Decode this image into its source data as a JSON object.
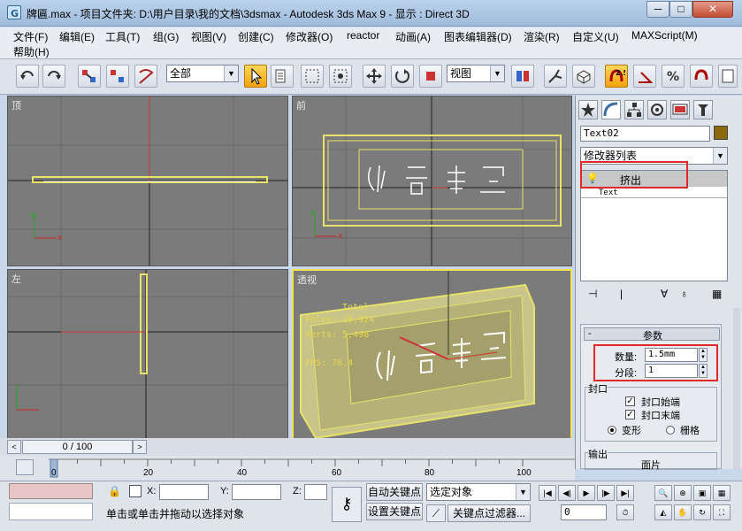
{
  "window": {
    "title": "牌匾.max      - 项目文件夹: D:\\用户目录\\我的文档\\3dsmax      - Autodesk 3ds Max 9      - 显示 : Direct 3D",
    "min": "─",
    "max": "□",
    "close": "✕"
  },
  "menu": [
    "文件(F)",
    "编辑(E)",
    "工具(T)",
    "组(G)",
    "视图(V)",
    "创建(C)",
    "修改器(O)",
    "reactor",
    "动画(A)",
    "图表编辑器(D)",
    "渲染(R)",
    "自定义(U)",
    "MAXScript(M)",
    "帮助(H)"
  ],
  "toolbar": {
    "selection_filter": "全部",
    "ref_coord": "视图",
    "snap_value": "2.5"
  },
  "viewports": {
    "top": {
      "label": "顶"
    },
    "front": {
      "label": "前"
    },
    "left": {
      "label": "左"
    },
    "perspective": {
      "label": "透视",
      "stats_total": "Total",
      "stats_polys": "Polys:  16,924",
      "stats_verts": "Verts:  5,498",
      "stats_fps": "FPS:    76.4"
    }
  },
  "command_panel": {
    "object_name": "Text02",
    "object_color": "#8b6a10",
    "modifier_list": "修改器列表",
    "stack": {
      "active": "挤出",
      "base": "Text"
    },
    "rollout_title": "参数",
    "amount_label": "数量:",
    "amount_value": "1.5mm",
    "segments_label": "分段:",
    "segments_value": "1",
    "capping_group": "封口",
    "cap_start": "封口始端",
    "cap_end": "封口末端",
    "morph": "变形",
    "grid": "栅格",
    "output_group": "输出",
    "patch": "面片"
  },
  "time": {
    "slider": "0 / 100",
    "ticks": [
      "0",
      "20",
      "40",
      "60",
      "80",
      "100"
    ]
  },
  "status": {
    "x_label": "X:",
    "y_label": "Y:",
    "z_label": "Z:",
    "auto_key": "自动关键点",
    "set_key": "设置关键点",
    "selected": "选定对象",
    "key_filters": "关键点过滤器...",
    "frame": "0",
    "prompt": "单击或单击并拖动以选择对象"
  },
  "colors": {
    "active_viewport": "#f5e24a",
    "highlight": "#e02a2a",
    "selection": "#e8e26a"
  }
}
